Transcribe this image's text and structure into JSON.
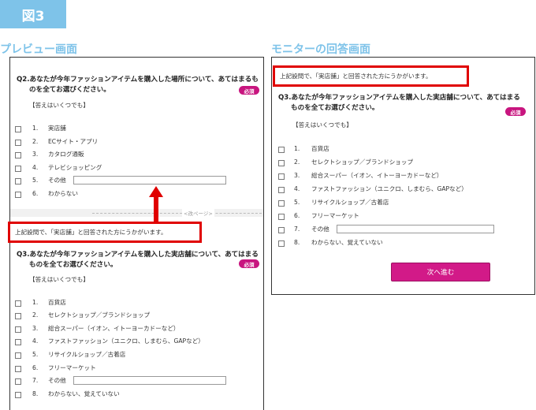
{
  "figure_label": "図3",
  "preview": {
    "heading": "プレビュー画面",
    "q2": {
      "title_line1": "Q2.あなたが今年ファッションアイテムを購入した場所について、あてはまるも",
      "title_line2": "のを全てお選びください。",
      "required": "必須",
      "hint": "【答えはいくつでも】",
      "options": [
        {
          "num": "1.",
          "label": "実店舗"
        },
        {
          "num": "2.",
          "label": "ECサイト・アプリ"
        },
        {
          "num": "3.",
          "label": "カタログ通販"
        },
        {
          "num": "4.",
          "label": "テレビショッピング"
        },
        {
          "num": "5.",
          "label": "その他"
        },
        {
          "num": "6.",
          "label": "わからない"
        }
      ]
    },
    "page_break": "<改ページ>",
    "message": "上記設問で、「実店舗」と回答された方にうかがいます。",
    "q3": {
      "title_line1": "Q3.あなたが今年ファッションアイテムを購入した実店舗について、あてはまる",
      "title_line2": "ものを全てお選びください。",
      "required": "必須",
      "hint": "【答えはいくつでも】",
      "options": [
        {
          "num": "1.",
          "label": "百貨店"
        },
        {
          "num": "2.",
          "label": "セレクトショップ／ブランドショップ"
        },
        {
          "num": "3.",
          "label": "総合スーパー（イオン、イトーヨーカドーなど）"
        },
        {
          "num": "4.",
          "label": "ファストファッション（ユニクロ、しまむら、GAPなど）"
        },
        {
          "num": "5.",
          "label": "リサイクルショップ／古着店"
        },
        {
          "num": "6.",
          "label": "フリーマーケット"
        },
        {
          "num": "7.",
          "label": "その他"
        },
        {
          "num": "8.",
          "label": "わからない、覚えていない"
        }
      ]
    }
  },
  "monitor": {
    "heading": "モニターの回答画面",
    "message": "上記設問で、「実店舗」と回答された方にうかがいます。",
    "q3": {
      "title_line1": "Q3.あなたが今年ファッションアイテムを購入した実店舗について、あてはまる",
      "title_line2": "ものを全てお選びください。",
      "required": "必須",
      "hint": "【答えはいくつでも】",
      "options": [
        {
          "num": "1.",
          "label": "百貨店"
        },
        {
          "num": "2.",
          "label": "セレクトショップ／ブランドショップ"
        },
        {
          "num": "3.",
          "label": "総合スーパー（イオン、イトーヨーカドーなど）"
        },
        {
          "num": "4.",
          "label": "ファストファッション（ユニクロ、しまむら、GAPなど）"
        },
        {
          "num": "5.",
          "label": "リサイクルショップ／古着店"
        },
        {
          "num": "6.",
          "label": "フリーマーケット"
        },
        {
          "num": "7.",
          "label": "その他"
        },
        {
          "num": "8.",
          "label": "わからない、覚えていない"
        }
      ]
    },
    "next_button": "次へ進む"
  },
  "colors": {
    "accent_blue": "#7ec3e9",
    "highlight_red": "#e00000",
    "badge_magenta": "#c8157f"
  }
}
